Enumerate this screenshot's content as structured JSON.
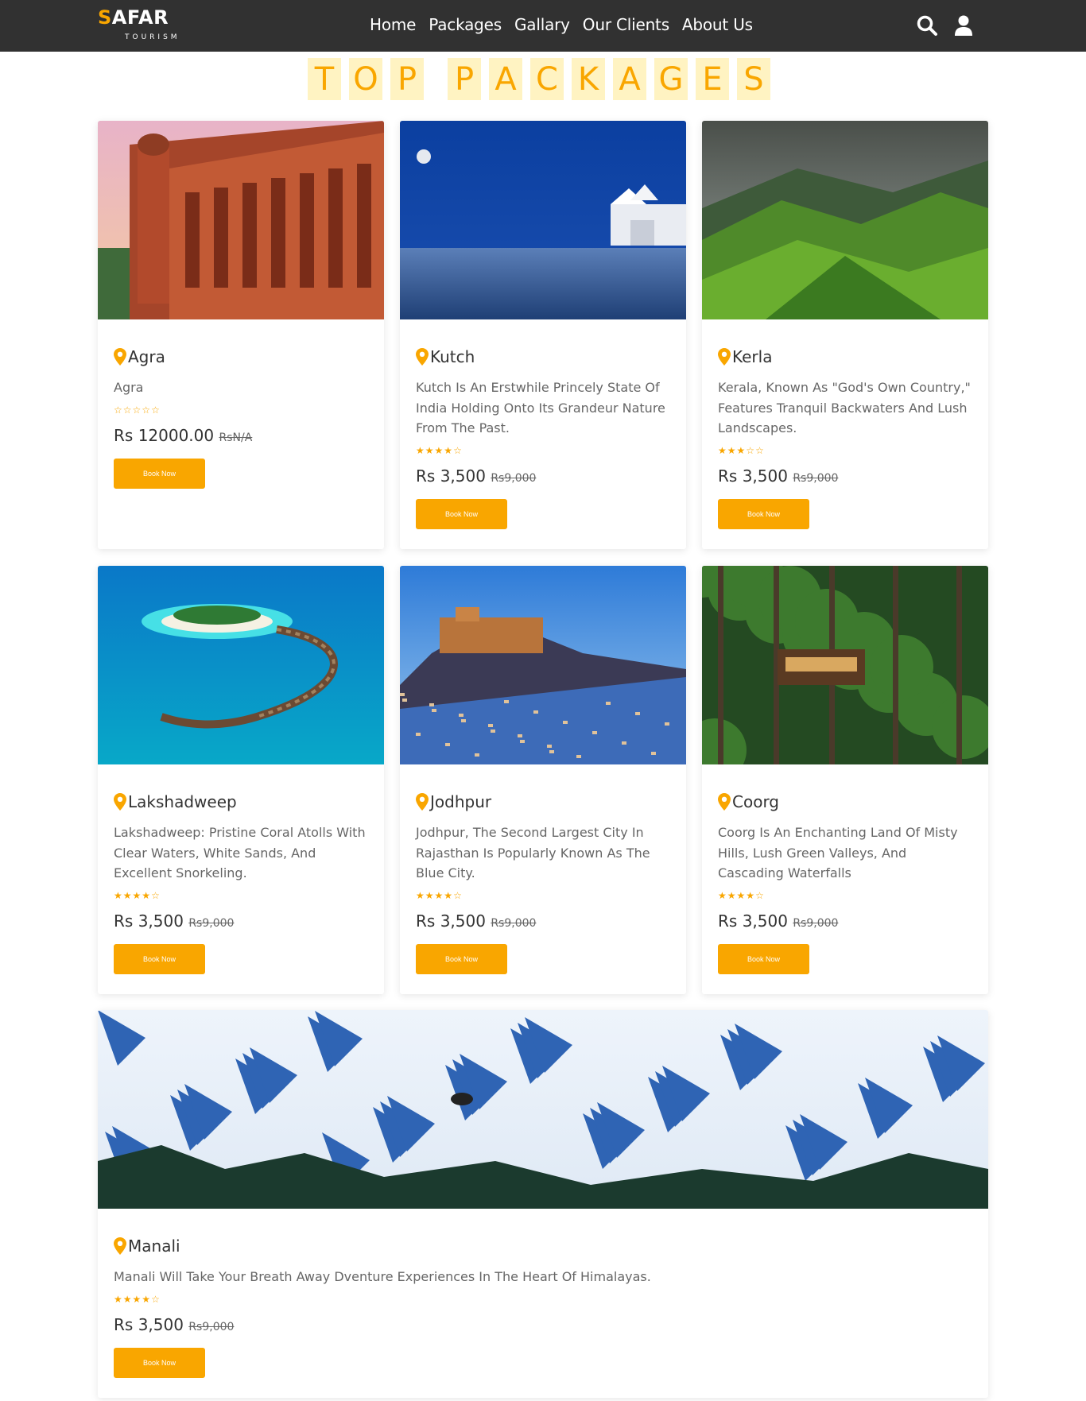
{
  "header": {
    "logo_first": "S",
    "logo_rest": "AFAR",
    "logo_sub": "TOURISM",
    "nav": [
      "Home",
      "Packages",
      "Gallary",
      "Our Clients",
      "About Us"
    ],
    "search_icon": "search-icon",
    "user_icon": "user-icon"
  },
  "section_title": [
    "T",
    "O",
    "P",
    "",
    "P",
    "A",
    "C",
    "K",
    "A",
    "G",
    "E",
    "S"
  ],
  "book_label": "Book Now",
  "currency": "Rs",
  "packages": [
    {
      "title": "Agra",
      "desc": "Agra",
      "rating": 0,
      "price": "12000.00",
      "old_price": "RsN/A",
      "image": "red-fort-palace"
    },
    {
      "title": "Kutch",
      "desc": "Kutch Is An Erstwhile Princely State Of India Holding Onto Its Grandeur Nature From The Past.",
      "rating": 4,
      "price": "3,500",
      "old_price": "Rs9,000",
      "image": "white-desert-tents"
    },
    {
      "title": "Kerla",
      "desc": "Kerala, Known As \"God's Own Country,\" Features Tranquil Backwaters And Lush Landscapes.",
      "rating": 3,
      "price": "3,500",
      "old_price": "Rs9,000",
      "image": "tea-hills"
    },
    {
      "title": "Lakshadweep",
      "desc": "Lakshadweep: Pristine Coral Atolls With Clear Waters, White Sands, And Excellent Snorkeling.",
      "rating": 4,
      "price": "3,500",
      "old_price": "Rs9,000",
      "image": "island-resort"
    },
    {
      "title": "Jodhpur",
      "desc": "Jodhpur, The Second Largest City In Rajasthan Is Popularly Known As The Blue City.",
      "rating": 4,
      "price": "3,500",
      "old_price": "Rs9,000",
      "image": "blue-city-fort"
    },
    {
      "title": "Coorg",
      "desc": "Coorg Is An Enchanting Land Of Misty Hills, Lush Green Valleys, And Cascading Waterfalls",
      "rating": 4,
      "price": "3,500",
      "old_price": "Rs9,000",
      "image": "forest-treehouse"
    },
    {
      "title": "Manali",
      "desc": "Manali Will Take Your Breath Away Dventure Experiences In The Heart Of Himalayas.",
      "rating": 4,
      "price": "3,500",
      "old_price": "Rs9,000",
      "image": "snow-mountains"
    }
  ],
  "colors": {
    "accent": "#f9a600",
    "nav_bg": "#313131",
    "title_bg": "#fff3c2"
  }
}
